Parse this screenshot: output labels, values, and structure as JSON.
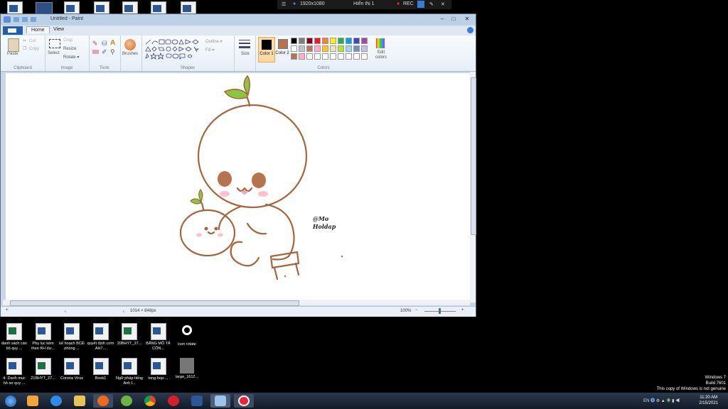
{
  "recorder": {
    "resolution": "1920x1080",
    "display": "Hiển thị 1",
    "rec": "REC"
  },
  "window": {
    "title": "Untitled - Paint",
    "minimize": "–",
    "maximize": "□",
    "close": "✕"
  },
  "tabs": [
    {
      "label": "Home"
    },
    {
      "label": "View"
    }
  ],
  "ribbon": {
    "clipboard": {
      "paste": "Paste",
      "cut": "Cut",
      "copy": "Copy",
      "group": "Clipboard"
    },
    "image": {
      "select": "Select",
      "crop": "Crop",
      "resize": "Resize",
      "rotate": "Rotate ▾",
      "group": "Image"
    },
    "tools": {
      "group": "Tools"
    },
    "brushes": {
      "label": "Brushes"
    },
    "shapes": {
      "outline": "Outline ▾",
      "fill": "Fill ▾",
      "group": "Shapes"
    },
    "size": {
      "label": "Size"
    },
    "colors": {
      "color1": "Color 1",
      "color2": "Color 2",
      "edit": "Edit colors",
      "group": "Colors",
      "row1": [
        "#000000",
        "#7f7f7f",
        "#880015",
        "#ed1c24",
        "#ff7f27",
        "#fff200",
        "#22b14c",
        "#00a2e8",
        "#3f48cc",
        "#a349a4"
      ],
      "row2": [
        "#ffffff",
        "#c3c3c3",
        "#b97a57",
        "#ffaec9",
        "#ffc90e",
        "#efe4b0",
        "#b5e61d",
        "#99d9ea",
        "#7092be",
        "#c8bfe7"
      ],
      "row3": [
        "#b5734e",
        "#ffaec9",
        "#ffffff",
        "#ffffff",
        "#ffffff",
        "#ffffff",
        "#ffffff",
        "#ffffff",
        "#ffffff",
        "#ffffff"
      ],
      "primary": "#000000",
      "secondary": "#b5734e"
    }
  },
  "canvas": {
    "signature_line1": "@Mo",
    "signature_line2": "Holdap"
  },
  "status": {
    "dimensions": "1014 × 848px",
    "zoom": "100%",
    "zoom_out": "−",
    "zoom_in": "+"
  },
  "desktop_icons": [
    {
      "label": "danh sách cán bộ quy ...",
      "type": "excel"
    },
    {
      "label": "Phụ lục kèm theo KH dự...",
      "type": "word"
    },
    {
      "label": "kế hoạch BCĐ phòng ...",
      "type": "word"
    },
    {
      "label": "quyết định cơm AH7...",
      "type": "word"
    },
    {
      "label": "20BHYT_27...",
      "type": "excel"
    },
    {
      "label": "BẢNG MÔ TẢ CÔN...",
      "type": "word"
    },
    {
      "label": "icon rotate",
      "type": "gear"
    },
    {
      "label": "4- Danh mục hồ sơ quy ...",
      "type": "word"
    },
    {
      "label": "21BHYT_27...",
      "type": "excel"
    },
    {
      "label": "Corona Virus",
      "type": "word"
    },
    {
      "label": "Book1",
      "type": "word"
    },
    {
      "label": "Ngữ pháp tiếng Anh l...",
      "type": "word"
    },
    {
      "label": "tong-hop-...",
      "type": "word"
    },
    {
      "label": "large_1612...",
      "type": "gray"
    }
  ],
  "watermark": {
    "line1": "Windows 7",
    "line2": "Build 7601",
    "line3": "This copy of Windows is not genuine"
  },
  "taskbar": {
    "lang": "EN",
    "time": "11:20 AM",
    "date": "2/15/2021"
  }
}
